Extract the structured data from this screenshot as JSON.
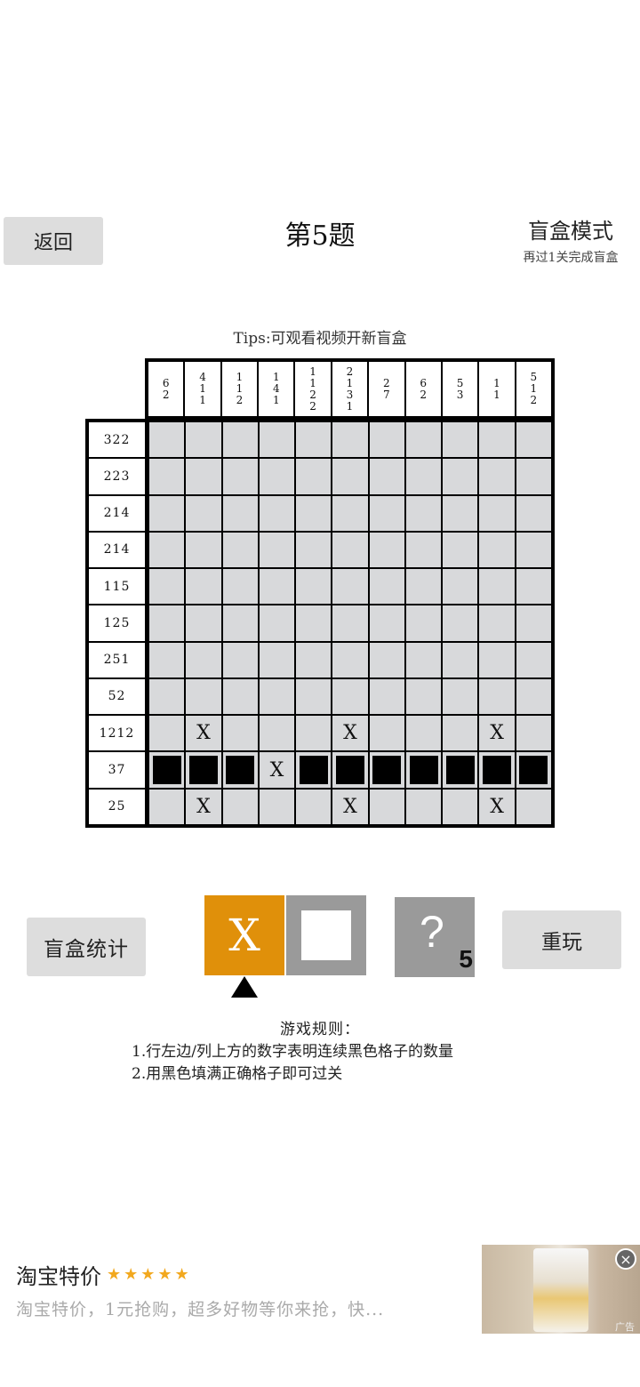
{
  "header": {
    "back_label": "返回",
    "title": "第5题",
    "mode": "盲盒模式",
    "mode_sub": "再过1关完成盲盒"
  },
  "tips": "Tips:可观看视频开新盲盒",
  "puzzle": {
    "col_clues": [
      "6\n2",
      "4\n1\n1",
      "1\n1\n2",
      "1\n4\n1",
      "1\n1\n2\n2",
      "2\n1\n3\n1",
      "2\n7",
      "6\n2",
      "5\n3",
      "1\n1",
      "5\n1\n2"
    ],
    "row_clues": [
      "322",
      "223",
      "214",
      "214",
      "115",
      "125",
      "251",
      "52",
      "1212",
      "37",
      "25"
    ],
    "grid": [
      "...........",
      "...........",
      "...........",
      "...........",
      "...........",
      "...........",
      "...........",
      "...........",
      ".x...x...x.",
      "###x#######",
      ".x...x...x."
    ],
    "x_mark": "X"
  },
  "controls": {
    "stats_label": "盲盒统计",
    "x_tool_label": "X",
    "hint_glyph": "?",
    "hint_count": "5",
    "replay_label": "重玩",
    "selected_tool": "x",
    "x_tool_color": "#e0900a"
  },
  "rules": {
    "title": "游戏规则：",
    "line1": "1.行左边/列上方的数字表明连续黑色格子的数量",
    "line2": "2.用黑色填满正确格子即可过关"
  },
  "ad": {
    "title": "淘宝特价",
    "stars": "★★★★★",
    "description": "淘宝特价，1元抢购，超多好物等你来抢，快...",
    "close_icon": "×",
    "tag": "广告"
  }
}
